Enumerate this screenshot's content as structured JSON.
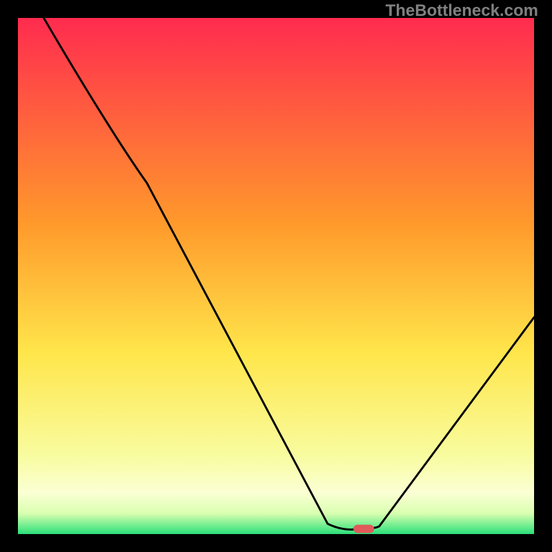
{
  "watermark": "TheBottleneck.com",
  "chart_data": {
    "type": "line",
    "title": "",
    "xlabel": "",
    "ylabel": "",
    "xlim": [
      0,
      100
    ],
    "ylim": [
      0,
      100
    ],
    "curve": [
      {
        "x": 5,
        "y": 100
      },
      {
        "x": 25,
        "y": 68
      },
      {
        "x": 60,
        "y": 2
      },
      {
        "x": 66,
        "y": 1
      },
      {
        "x": 70,
        "y": 1.5
      },
      {
        "x": 100,
        "y": 42
      }
    ],
    "marker": {
      "x": 67,
      "y": 1,
      "color": "#e05a5a"
    },
    "gradient_stops": [
      {
        "offset": 0,
        "color": "#ff2b4f"
      },
      {
        "offset": 40,
        "color": "#ff9a2b"
      },
      {
        "offset": 65,
        "color": "#ffe64b"
      },
      {
        "offset": 85,
        "color": "#f8fca0"
      },
      {
        "offset": 92,
        "color": "#fbffd4"
      },
      {
        "offset": 96,
        "color": "#d9ffb0"
      },
      {
        "offset": 100,
        "color": "#2ae07a"
      }
    ]
  }
}
